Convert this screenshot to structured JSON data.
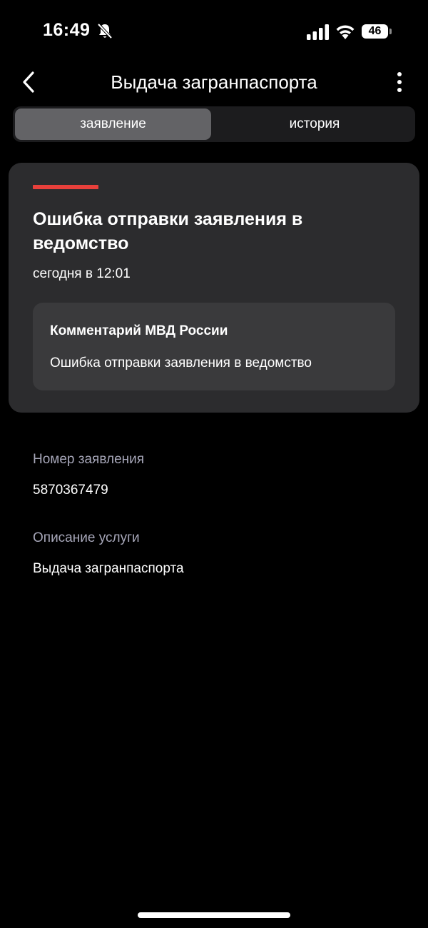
{
  "status_bar": {
    "time": "16:49",
    "battery_level": "46",
    "icons": [
      "bell-slash-icon",
      "cellular-signal-icon",
      "wifi-icon",
      "battery-icon"
    ]
  },
  "nav": {
    "title": "Выдача загранпаспорта",
    "back_icon": "chevron-left-icon",
    "more_icon": "more-vertical-icon"
  },
  "tabs": [
    {
      "label": "заявление",
      "active": true
    },
    {
      "label": "история",
      "active": false
    }
  ],
  "status_card": {
    "title": "Ошибка отправки заявления в ведомство",
    "time": "сегодня в 12:01",
    "accent_color": "#e8403b",
    "comment": {
      "author": "Комментарий МВД России",
      "text": "Ошибка отправки заявления в ведомство"
    }
  },
  "details": [
    {
      "label": "Номер заявления",
      "value": "5870367479"
    },
    {
      "label": "Описание услуги",
      "value": "Выдача загранпаспорта"
    }
  ],
  "colors": {
    "background": "#000000",
    "card": "#2c2c2e",
    "inner_card": "#3a3a3c",
    "label": "#a6a6b8",
    "error": "#e8403b"
  }
}
